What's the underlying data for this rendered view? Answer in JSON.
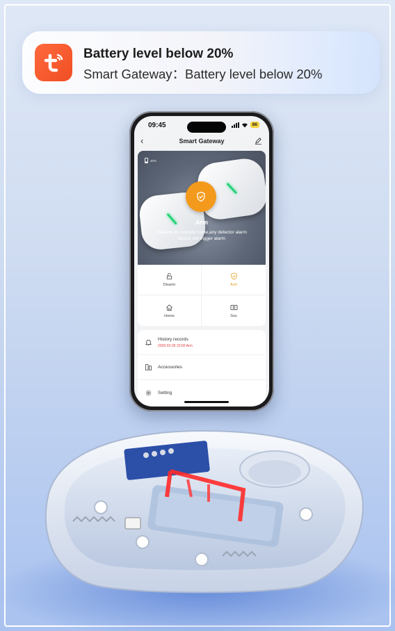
{
  "notification": {
    "app_icon": "tuya-smart-app-icon",
    "title": "Battery level below 20%",
    "body": "Smart Gateway：Battery level below 20%"
  },
  "phone": {
    "status": {
      "time": "09:45",
      "battery": "86"
    },
    "header": {
      "back_icon": "chevron-left-icon",
      "title": "Smart Gateway",
      "edit_icon": "pencil-icon"
    },
    "hero": {
      "battery_label": "30%",
      "mode_title": "Arm",
      "mode_desc": "Suitable for nobody home,any detector alarm device will trigger alarm"
    },
    "modes": [
      {
        "label": "Disarm",
        "icon": "unlock-icon",
        "active": false
      },
      {
        "label": "Arm",
        "icon": "shield-check-icon",
        "active": true
      },
      {
        "label": "Home",
        "icon": "home-icon",
        "active": false
      },
      {
        "label": "Sos",
        "icon": "sos-icon",
        "active": false
      }
    ],
    "list": [
      {
        "label": "History records",
        "sub": "2026-02-26 23:00 Arm",
        "icon": "bell-icon"
      },
      {
        "label": "Accessories",
        "sub": "",
        "icon": "accessories-icon"
      },
      {
        "label": "Setting",
        "sub": "",
        "icon": "gear-icon"
      }
    ]
  },
  "colors": {
    "accent_orange": "#f39a1c",
    "app_icon": "#f04e23",
    "history_red": "#e23b3b",
    "gateway_highlight": "#ff2a2a"
  }
}
